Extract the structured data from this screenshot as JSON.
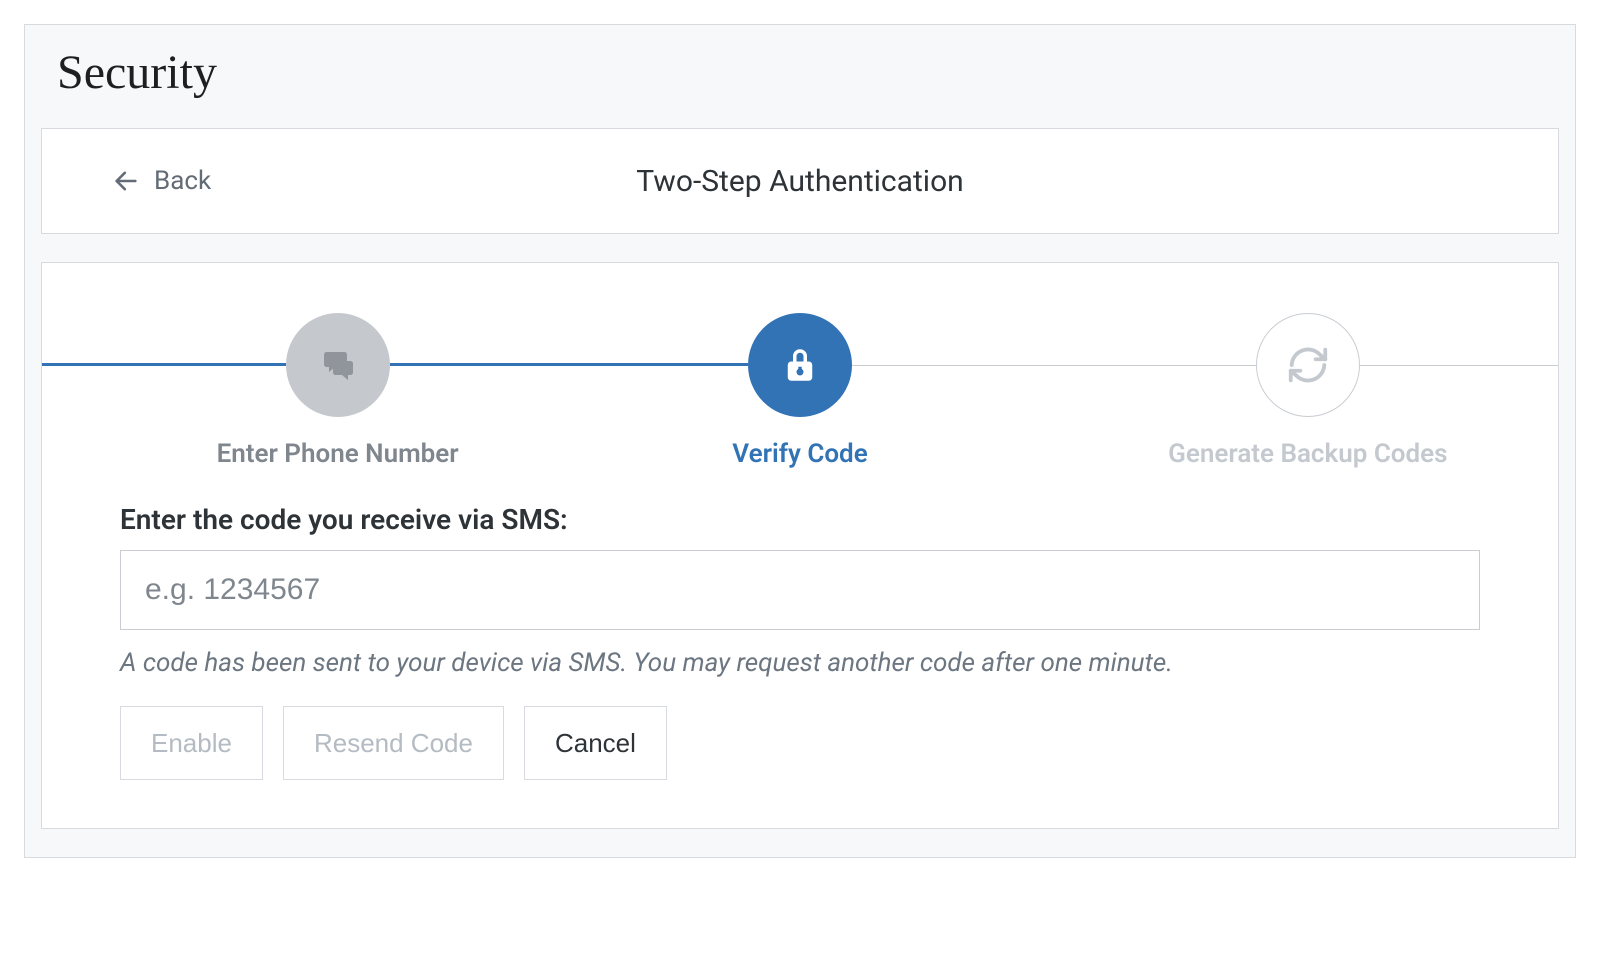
{
  "page": {
    "title": "Security"
  },
  "header": {
    "back_label": "Back",
    "title": "Two-Step Authentication"
  },
  "steps": {
    "phone": {
      "label": "Enter Phone Number",
      "state": "done"
    },
    "verify": {
      "label": "Verify Code",
      "state": "active"
    },
    "backup": {
      "label": "Generate Backup Codes",
      "state": "pending"
    }
  },
  "form": {
    "label": "Enter the code you receive via SMS:",
    "placeholder": "e.g. 1234567",
    "value": "",
    "help": "A code has been sent to your device via SMS. You may request another code after one minute."
  },
  "buttons": {
    "enable": "Enable",
    "resend": "Resend Code",
    "cancel": "Cancel"
  }
}
